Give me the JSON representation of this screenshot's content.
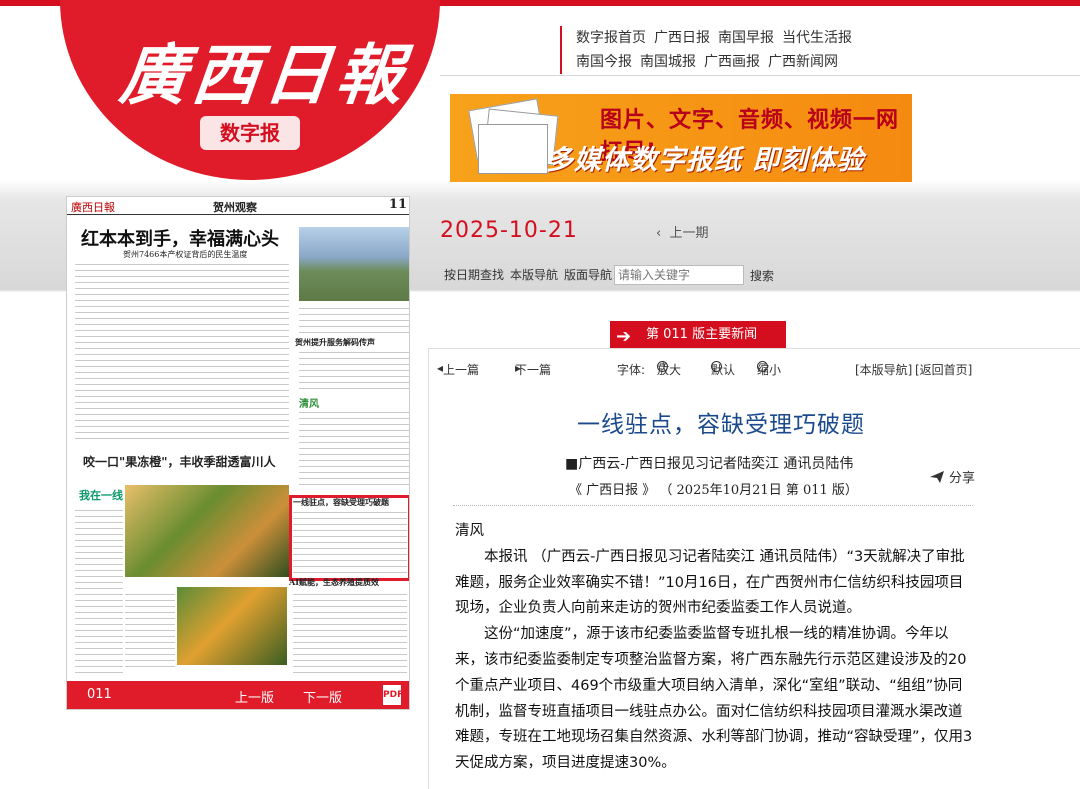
{
  "header": {
    "logo": "廣西日報",
    "logo_sub": "数字报",
    "links_row1": [
      "数字报首页",
      "广西日报",
      "南国早报",
      "当代生活报"
    ],
    "links_row2": [
      "南国今报",
      "南国城报",
      "广西画报",
      "广西新闻网"
    ]
  },
  "banner": {
    "line1": "图片、文字、音频、视频一网打尽!",
    "line2": "多媒体数字报纸  即刻体验"
  },
  "thumbnail": {
    "section_name": "贺州观察",
    "page_num": "11",
    "headline": "红本本到手，幸福满心头",
    "subhead": "贺州7466本产权证背后的民生温度",
    "headline2": "咬一口\"果冻橙\"，丰收季甜透富川人",
    "related_title": "一线驻点，容缺受理巧破题",
    "section2": "贺州提升服务解码传声",
    "qingfeng": "清风",
    "ai_title": "AI赋能，生态养殖提质效",
    "green_logo": "我在一线",
    "footer_page": "011",
    "footer_prev": "上一版",
    "footer_next": "下一版",
    "pdf_label": "PDF"
  },
  "date": "2025-10-21",
  "prev_day": "上一期",
  "nav": {
    "by_date": "按日期查找",
    "edition_nav": "本版导航",
    "page_nav": "版面导航",
    "search_placeholder": "请输入关键字",
    "search_button": "搜索"
  },
  "section_tab": "第 011 版主要新闻",
  "toolbar": {
    "prev_article": "上一篇",
    "next_article": "下一篇",
    "font_label": "字体:",
    "font_big": "放大",
    "font_default": "默认",
    "font_small": "缩小",
    "edition_nav": "[本版导航]",
    "back_home": "[返回首页]"
  },
  "article": {
    "title": "一线驻点，容缺受理巧破题",
    "author": "■广西云-广西日报见习记者陆奕江 通讯员陆伟",
    "source": "《 广西日报 》 （ 2025年10月21日    第 011 版）",
    "share": "分享",
    "column": "清风",
    "para1": "本报讯 （广西云-广西日报见习记者陆奕江 通讯员陆伟）“3天就解决了审批难题，服务企业效率确实不错！”10月16日，在广西贺州市仁信纺织科技园项目现场，企业负责人向前来走访的贺州市纪委监委工作人员说道。",
    "para2": "这份“加速度”，源于该市纪委监委监督专班扎根一线的精准协调。今年以来，该市纪委监委制定专项整治监督方案，将广西东融先行示范区建设涉及的20个重点产业项目、469个市级重大项目纳入清单，深化“室组”联动、“组组”协同机制，监督专班直插项目一线驻点办公。面对仁信纺织科技园项目灌溉水渠改道难题，专班在工地现场召集自然资源、水利等部门协调，推动“容缺受理”，仅用3天促成方案，项目进度提速30%。"
  },
  "colors": {
    "brand_red": "#d40e1e",
    "title_blue": "#1b4a8c",
    "banner_orange": "#f58a10"
  }
}
